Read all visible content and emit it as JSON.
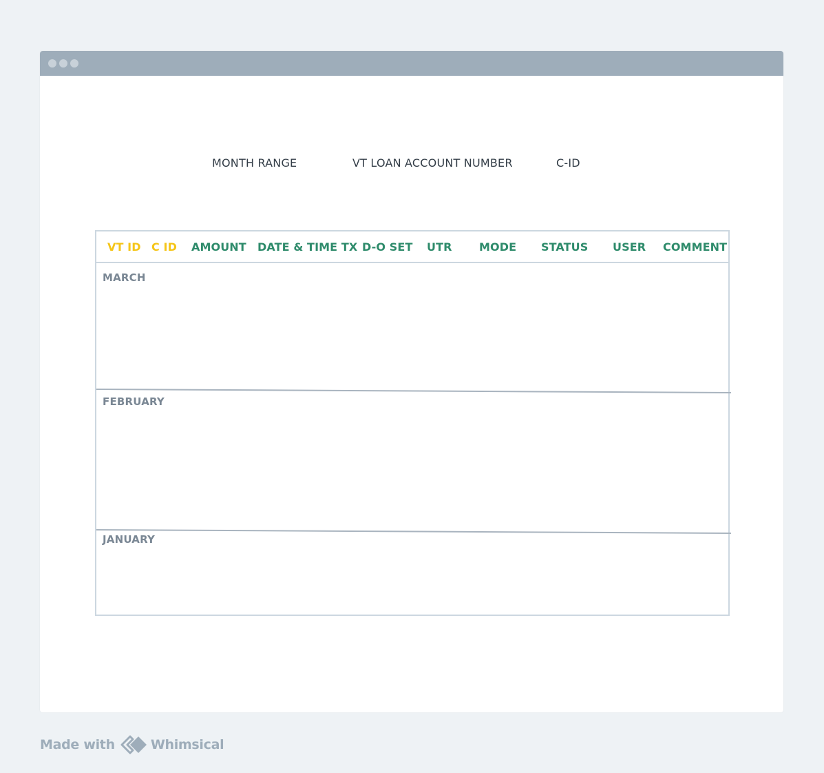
{
  "filters": {
    "month_range": "MONTH RANGE",
    "vt_loan_account_number": "VT LOAN ACCOUNT NUMBER",
    "c_id": "C-ID"
  },
  "table": {
    "columns": [
      {
        "label": "VT ID",
        "color": "#f5c518"
      },
      {
        "label": "C ID",
        "color": "#f5c518"
      },
      {
        "label": "AMOUNT",
        "color": "#2e8b6b"
      },
      {
        "label": "DATE & TIME TX",
        "color": "#2e8b6b"
      },
      {
        "label": "D-O SET",
        "color": "#2e8b6b"
      },
      {
        "label": "UTR",
        "color": "#2e8b6b"
      },
      {
        "label": "MODE",
        "color": "#2e8b6b"
      },
      {
        "label": "STATUS",
        "color": "#2e8b6b"
      },
      {
        "label": "USER",
        "color": "#2e8b6b"
      },
      {
        "label": "COMMENT",
        "color": "#2e8b6b"
      }
    ],
    "sections": [
      "MARCH",
      "FEBRUARY",
      "JANUARY"
    ]
  },
  "footer": {
    "made_with": "Made with",
    "brand": "Whimsical",
    "brand_icon": "whimsical-logo-icon"
  },
  "colors": {
    "titlebar": "#9eadba",
    "highlight_column": "#f5c518",
    "column": "#2e8b6b",
    "section_label": "#7a8794"
  }
}
